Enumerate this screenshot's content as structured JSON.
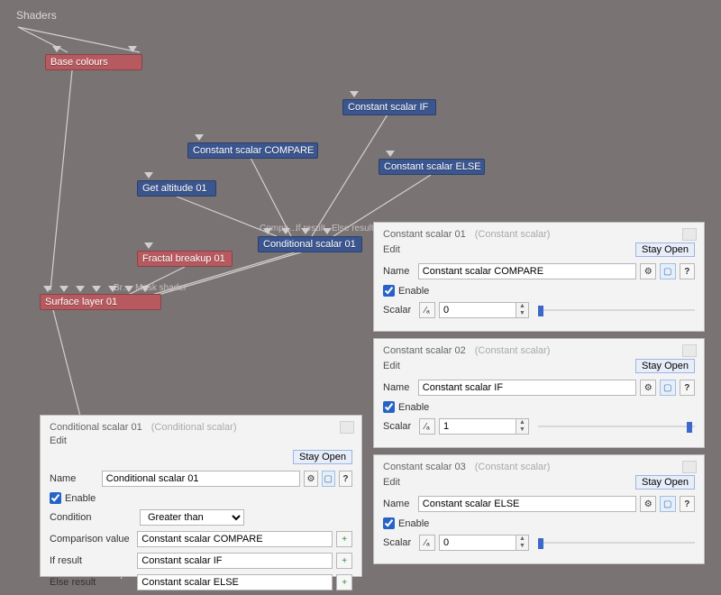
{
  "window_title": "Shaders",
  "nodes": {
    "base_colours": {
      "label": "Base colours"
    },
    "constant_if": {
      "label": "Constant scalar IF"
    },
    "constant_compare": {
      "label": "Constant scalar COMPARE"
    },
    "constant_else": {
      "label": "Constant scalar ELSE"
    },
    "get_altitude": {
      "label": "Get altitude 01"
    },
    "conditional_scalar": {
      "label": "Conditional scalar 01"
    },
    "fractal_breakup": {
      "label": "Fractal breakup 01"
    },
    "surface_layer": {
      "label": "Surface layer 01"
    }
  },
  "port_labels": {
    "compa": "Compa…",
    "if_result": "If result",
    "else_result": "Else result",
    "br": "Br…",
    "mask_shader": "Mask shader"
  },
  "panel_conditional": {
    "title": "Conditional scalar 01",
    "type": "(Conditional scalar)",
    "edit": "Edit",
    "stay_open": "Stay Open",
    "labels": {
      "name": "Name",
      "enable": "Enable",
      "condition": "Condition",
      "comparison_value": "Comparison value",
      "if_result": "If result",
      "else_result": "Else result"
    },
    "values": {
      "name": "Conditional scalar 01",
      "enable": true,
      "condition": "Greater than",
      "comparison_value": "Constant scalar COMPARE",
      "if_result": "Constant scalar IF",
      "else_result": "Constant scalar ELSE"
    },
    "icons": {
      "gear": "⚙",
      "add": "+",
      "help": "?"
    }
  },
  "scalar_panels": [
    {
      "title": "Constant scalar 01",
      "type": "(Constant scalar)",
      "edit": "Edit",
      "stay_open": "Stay Open",
      "labels": {
        "name": "Name",
        "enable": "Enable",
        "scalar": "Scalar"
      },
      "values": {
        "name": "Constant scalar COMPARE",
        "enable": true,
        "scalar": "0"
      },
      "slider_pos_pct": 2
    },
    {
      "title": "Constant scalar 02",
      "type": "(Constant scalar)",
      "edit": "Edit",
      "stay_open": "Stay Open",
      "labels": {
        "name": "Name",
        "enable": "Enable",
        "scalar": "Scalar"
      },
      "values": {
        "name": "Constant scalar IF",
        "enable": true,
        "scalar": "1"
      },
      "slider_pos_pct": 98
    },
    {
      "title": "Constant scalar 03",
      "type": "(Constant scalar)",
      "edit": "Edit",
      "stay_open": "Stay Open",
      "labels": {
        "name": "Name",
        "enable": "Enable",
        "scalar": "Scalar"
      },
      "values": {
        "name": "Constant scalar ELSE",
        "enable": true,
        "scalar": "0"
      },
      "slider_pos_pct": 2
    }
  ],
  "icons": {
    "gear": "⚙",
    "color": "▦",
    "help": "?",
    "add": "+",
    "spin": "⁄ₐ"
  }
}
